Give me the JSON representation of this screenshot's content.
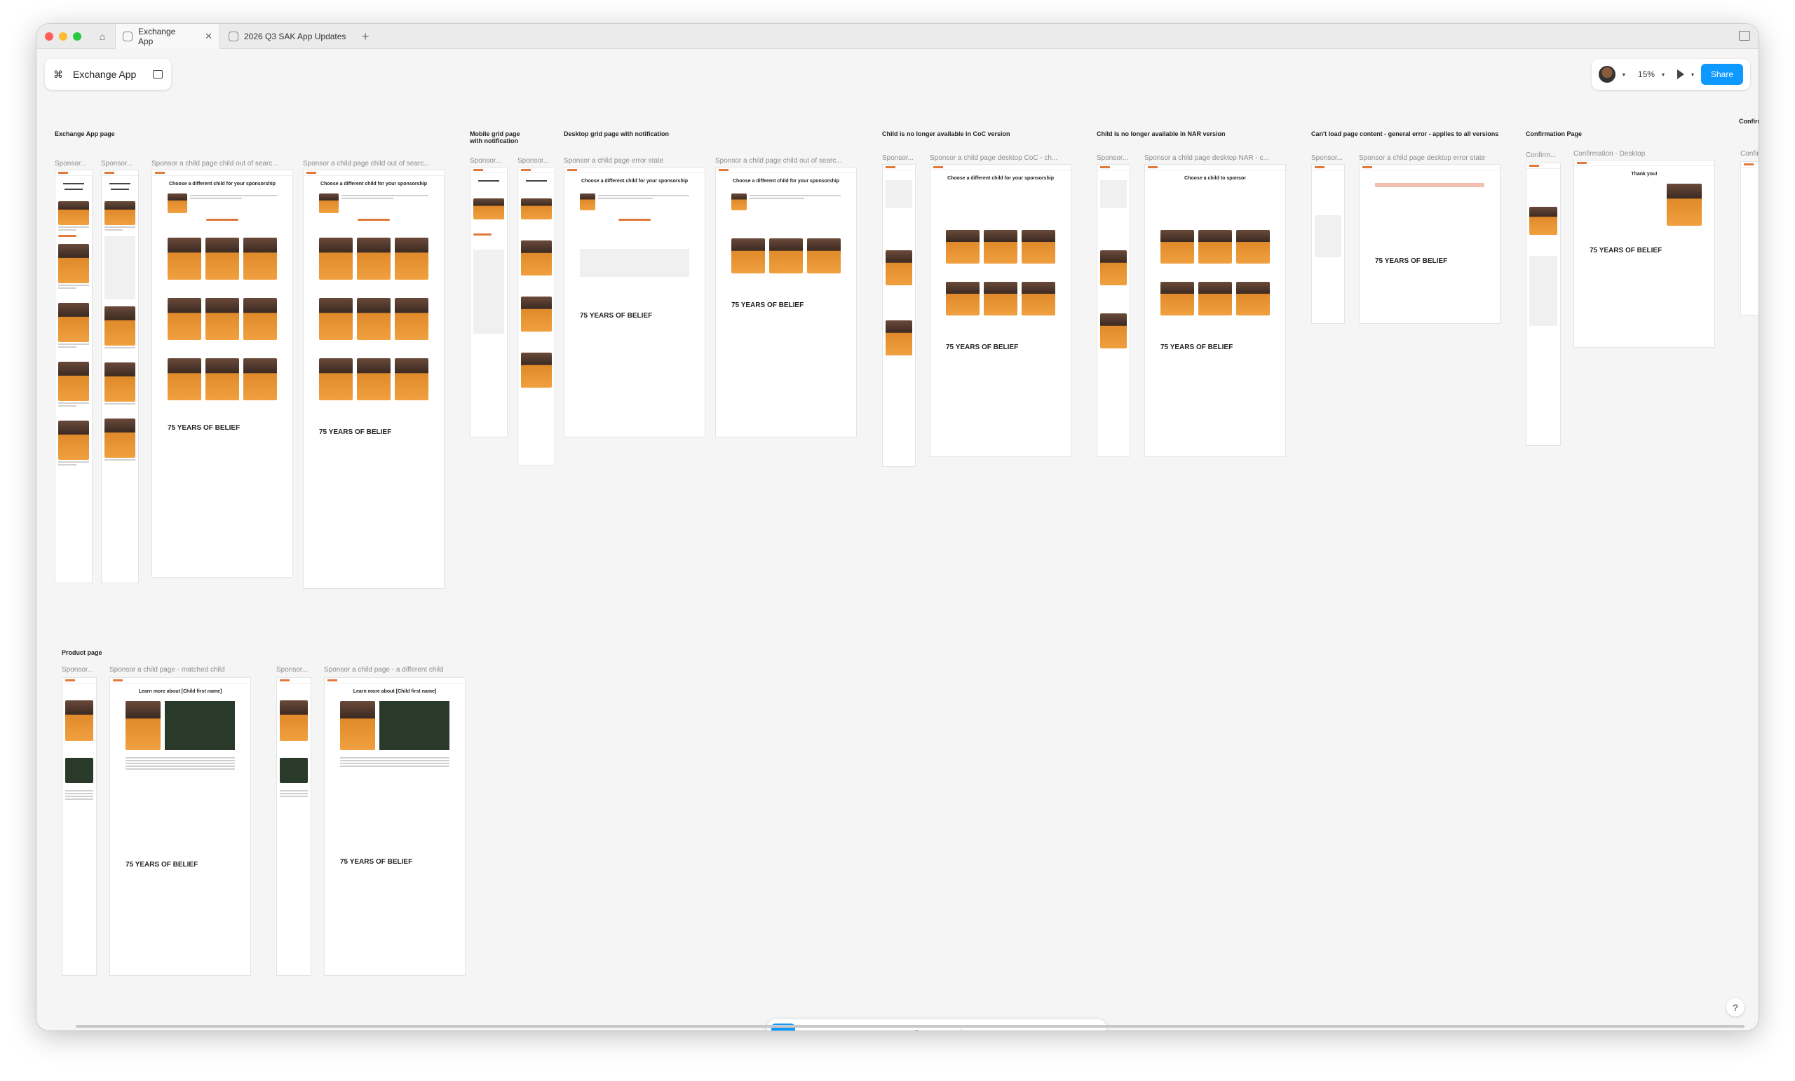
{
  "tabs": [
    {
      "label": "Exchange App",
      "active": true
    },
    {
      "label": "2026 Q3 SAK App Updates",
      "active": false
    }
  ],
  "file": {
    "name": "Exchange App"
  },
  "header": {
    "zoom": "15%",
    "share_label": "Share"
  },
  "sections": {
    "exchange_app_page": "Exchange App page",
    "mobile_grid_notification": "Mobile grid page with notification",
    "desktop_grid_notification": "Desktop grid page with notification",
    "child_no_longer_coc": "Child is no longer available in CoC version",
    "child_no_longer_nar": "Child is no longer available in NAR version",
    "cant_load": "Can't load page content - general error - applies to all versions",
    "confirmation_page": "Confirmation Page",
    "confirm_cut": "Confirm",
    "product_page": "Product page"
  },
  "frames": {
    "f1": "Sponsor...",
    "f2": "Sponsor...",
    "f3": "Sponsor a child page child out of searc...",
    "f4": "Sponsor a child page child out of searc...",
    "f5": "Sponsor...",
    "f6": "Sponsor...",
    "f7": "Sponsor a child page error state",
    "f8": "Sponsor a child page child out of searc...",
    "f9": "Sponsor...",
    "f10": "Sponsor a child page desktop CoC - ch...",
    "f11": "Sponsor...",
    "f12": "Sponsor a child page desktop NAR - c...",
    "f13": "Sponsor...",
    "f14": "Sponsor a child page desktop error state",
    "f15": "Confirm...",
    "f16": "Confirmation - Desktop",
    "f17": "Confir...",
    "p1": "Sponsor...",
    "p2": "Sponsor a child page - matched child",
    "p3": "Sponsor...",
    "p4": "Sponsor a child page - a different child"
  },
  "frame_text": {
    "choose_different": "Choose a different child for your sponsorship",
    "choose_child": "Choose a child to sponsor",
    "thank_you": "Thank you!",
    "learn_more": "Learn more about [Child first name]",
    "belief": "75 YEARS OF BELIEF"
  },
  "toolbar": {
    "tools": [
      "move-tool",
      "frame-tool",
      "shape-tool",
      "pen-tool",
      "text-tool",
      "comment-tool",
      "actions-tool",
      "draw-mode",
      "design-mode",
      "dev-mode",
      "code-mode"
    ]
  },
  "help_label": "?"
}
